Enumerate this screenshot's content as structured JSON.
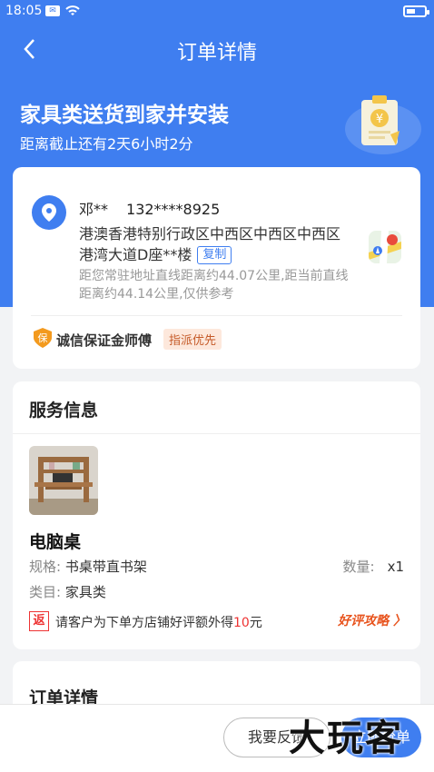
{
  "status_bar": {
    "time": "18:05",
    "msg_icon": "message-icon",
    "wifi_icon": "wifi-icon",
    "battery_icon": "battery-icon"
  },
  "nav": {
    "title": "订单详情",
    "back_icon": "back-chevron-icon"
  },
  "hero": {
    "title": "家具类送货到家并安装",
    "deadline": "距离截止还有2天6小时2分"
  },
  "address": {
    "name": "邓**",
    "phone": "132****8925",
    "line1": "港澳香港特别行政区中西区中西区中西区",
    "line2": "港湾大道D座**楼",
    "copy_label": "复制",
    "distance": "距您常驻地址直线距离约44.07公里,距当前直线距离约44.14公里,仅供参考",
    "certification": "诚信保证金师傅",
    "cert_icon_char": "保",
    "priority": "指派优先"
  },
  "service": {
    "section_title": "服务信息",
    "product_name": "电脑桌",
    "spec_key": "规格:",
    "spec_value": "书桌带直书架",
    "qty_key": "数量:",
    "qty_value": "x1",
    "category_key": "类目:",
    "category_value": "家具类",
    "rebate_icon_char": "返",
    "rebate_prefix": "请客户为下单方店铺好评额外得",
    "rebate_amount": "10",
    "rebate_suffix": "元",
    "review_link": "好评攻略 〉"
  },
  "order_details": {
    "title": "订单详情"
  },
  "bottom": {
    "feedback_label": "我要反馈",
    "grab_label": "立即抢单"
  },
  "watermark": "大玩客",
  "colors": {
    "primary": "#3f7ef0",
    "accent_red": "#e33333",
    "accent_orange": "#e8541e"
  }
}
